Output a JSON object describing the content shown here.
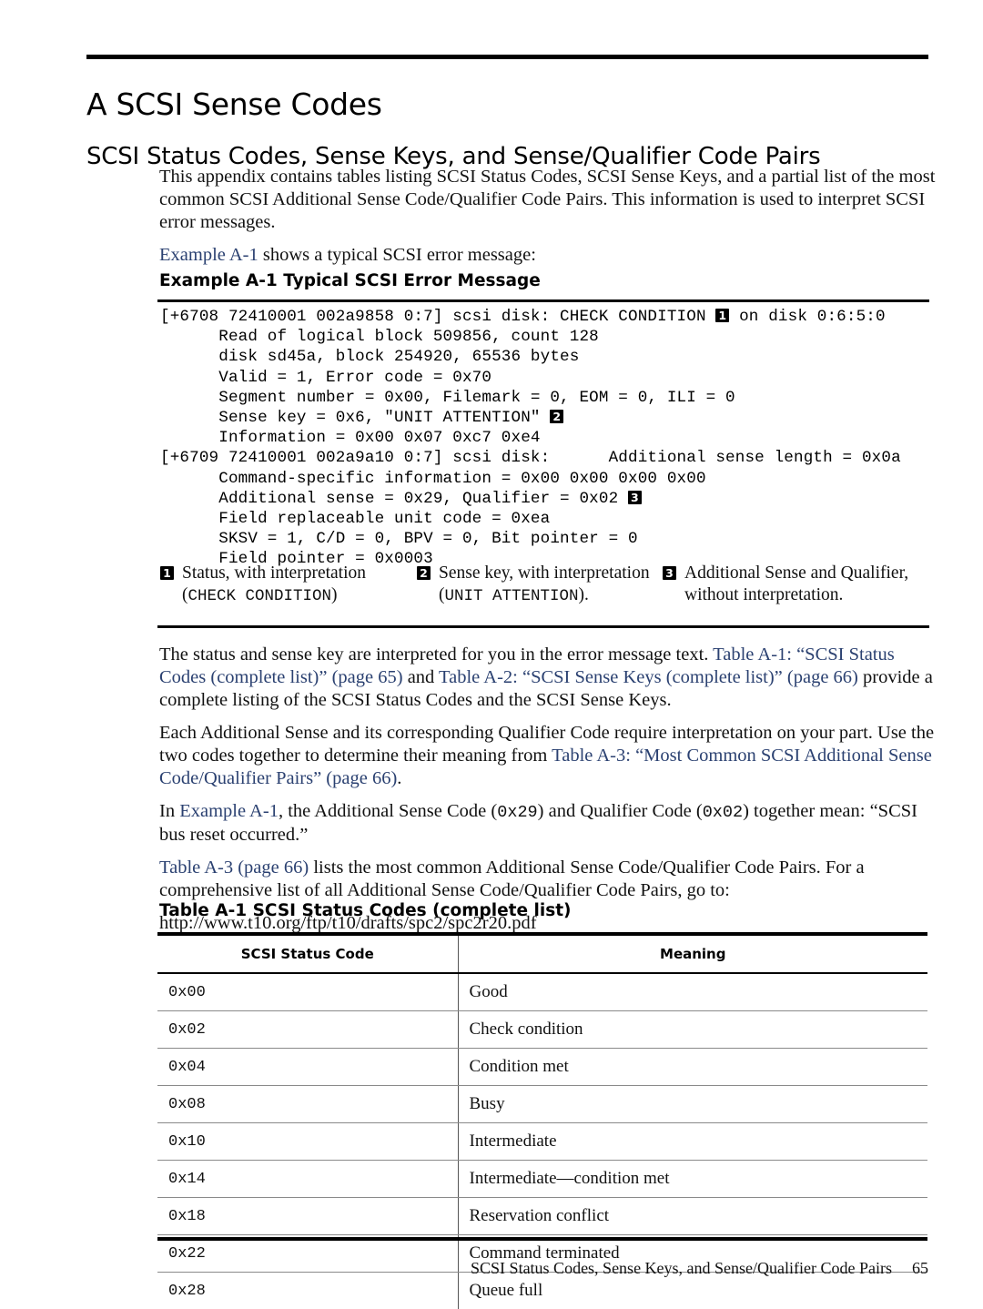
{
  "chapter": {
    "title": "A SCSI Sense Codes"
  },
  "section": {
    "title": "SCSI Status Codes, Sense Keys, and Sense/Qualifier Code Pairs"
  },
  "intro": {
    "paragraph1": "This appendix contains tables listing SCSI Status Codes, SCSI Sense Keys, and a partial list of the most common SCSI Additional Sense Code/Qualifier Code Pairs. This information is used to interpret SCSI error messages.",
    "lead_link": "Example A-1",
    "lead_rest": " shows a typical SCSI error message:"
  },
  "example": {
    "label": "Example  A-1  Typical SCSI Error Message",
    "code_lines": [
      "[+6708 72410001 002a9858 0:7] scsi disk: CHECK CONDITION \u0001 on disk 0:6:5:0",
      "      Read of logical block 509856, count 128",
      "      disk sd45a, block 254920, 65536 bytes",
      "      Valid = 1, Error code = 0x70",
      "      Segment number = 0x00, Filemark = 0, EOM = 0, ILI = 0",
      "      Sense key = 0x6, \"UNIT ATTENTION\" \u0002",
      "      Information = 0x00 0x07 0xc7 0xe4",
      "[+6709 72410001 002a9a10 0:7] scsi disk:      Additional sense length = 0x0a",
      "      Command-specific information = 0x00 0x00 0x00 0x00",
      "      Additional sense = 0x29, Qualifier = 0x02 \u0003",
      "      Field replaceable unit code = 0xea",
      "      SKSV = 1, C/D = 0, BPV = 0, Bit pointer = 0",
      "      Field pointer = 0x0003"
    ]
  },
  "legend": {
    "items": [
      {
        "number": "1",
        "text_before": "Status, with interpretation (",
        "mono": "CHECK CONDITION",
        "text_after": ")"
      },
      {
        "number": "2",
        "text_before": "Sense key, with interpretation (",
        "mono": "UNIT ATTENTION",
        "text_after": ")."
      },
      {
        "number": "3",
        "text_before": "Additional Sense and Qualifier, without interpretation.",
        "mono": "",
        "text_after": ""
      }
    ]
  },
  "body": {
    "p1_part1": "The status and sense key are interpreted for you in the error message text. ",
    "p1_link1": "Table A-1: “SCSI Status Codes (complete list)” (page 65)",
    "p1_part2": " and ",
    "p1_link2": "Table A-2: “SCSI Sense Keys (complete list)” (page 66)",
    "p1_part3": " provide a complete listing of the SCSI Status Codes and the SCSI Sense Keys.",
    "p2_part1": "Each Additional Sense and its corresponding Qualifier Code require interpretation on your part. Use the two codes together to determine their meaning from ",
    "p2_link1": "Table A-3: “Most Common SCSI Additional Sense Code/Qualifier Pairs” (page 66)",
    "p2_part2": ".",
    "p3_part1": "In ",
    "p3_link1": "Example A-1",
    "p3_part2": ", the Additional Sense Code (",
    "p3_code1": "0x29",
    "p3_part3": ") and Qualifier Code (",
    "p3_code2": "0x02",
    "p3_part4": ") together mean: “SCSI bus reset occurred.”",
    "p4_link1": "Table A-3 (page 66)",
    "p4_part1": " lists the most common Additional Sense Code/Qualifier Code Pairs. For a comprehensive list of all Additional Sense Code/Qualifier Code Pairs, go to:",
    "p5_url": "http://www.t10.org/ftp/t10/drafts/spc2/spc2r20.pdf"
  },
  "table": {
    "caption": "Table  A-1  SCSI Status Codes (complete list)",
    "headers": [
      "SCSI Status Code",
      "Meaning"
    ],
    "rows": [
      [
        "0x00",
        "Good"
      ],
      [
        "0x02",
        "Check condition"
      ],
      [
        "0x04",
        "Condition met"
      ],
      [
        "0x08",
        "Busy"
      ],
      [
        "0x10",
        "Intermediate"
      ],
      [
        "0x14",
        "Intermediate—condition met"
      ],
      [
        "0x18",
        "Reservation conflict"
      ],
      [
        "0x22",
        "Command terminated"
      ],
      [
        "0x28",
        "Queue full"
      ]
    ]
  },
  "footer": {
    "text": "SCSI Status Codes, Sense Keys, and Sense/Qualifier Code Pairs",
    "page_number": "65"
  },
  "colors": {
    "link": "#2b4171",
    "rule": "#000000",
    "text": "#111111"
  }
}
